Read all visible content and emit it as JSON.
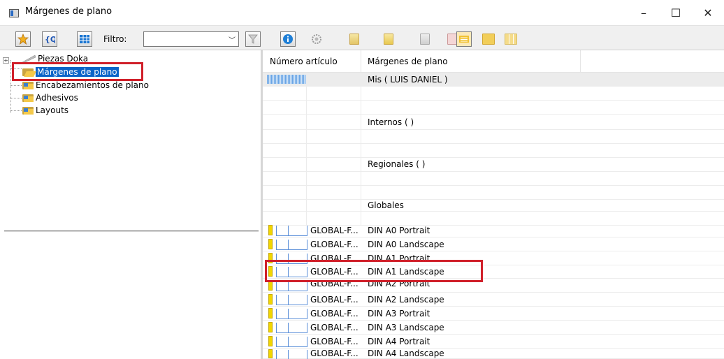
{
  "window": {
    "title": "Márgenes de plano",
    "min_glyph": "–",
    "max_glyph": "☐",
    "close_glyph": "✕"
  },
  "toolbar": {
    "filter_label": "Filtro:",
    "filter_value": "",
    "buttons": [
      "favorites-star-icon",
      "search-reload-icon",
      "grid-view-icon",
      "filter-funnel-icon",
      "info-icon",
      "settings-gear-icon",
      "document-1-icon",
      "document-2-icon",
      "document-3-icon",
      "list-view-icon",
      "details-view-icon",
      "columns-view-icon"
    ]
  },
  "tree": {
    "items": [
      {
        "label": "Piezas Doka"
      },
      {
        "label": "Márgenes de plano"
      },
      {
        "label": "Encabezamientos de plano"
      },
      {
        "label": "Adhesivos"
      },
      {
        "label": "Layouts"
      }
    ]
  },
  "grid": {
    "col_article": "Número artículo",
    "col_margins": "Márgenes de plano",
    "groups": {
      "mis": "Mis ( LUIS DANIEL )",
      "internos": "Internos ( )",
      "regionales": "Regionales ( )",
      "globales": "Globales"
    },
    "rows": [
      {
        "article": "GLOBAL-F...",
        "name": "DIN A0 Portrait"
      },
      {
        "article": "GLOBAL-F...",
        "name": "DIN A0 Landscape"
      },
      {
        "article": "GLOBAL-F...",
        "name": "DIN A1 Portrait"
      },
      {
        "article": "GLOBAL-F...",
        "name": "DIN A1 Landscape"
      },
      {
        "article": "GLOBAL-F...",
        "name": "DIN A2 Portrait"
      },
      {
        "article": "GLOBAL-F...",
        "name": "DIN A2 Landscape"
      },
      {
        "article": "GLOBAL-F...",
        "name": "DIN A3 Portrait"
      },
      {
        "article": "GLOBAL-F...",
        "name": "DIN A3 Landscape"
      },
      {
        "article": "GLOBAL-F...",
        "name": "DIN A4 Portrait"
      },
      {
        "article": "GLOBAL-F...",
        "name": "DIN A4 Landscape"
      }
    ]
  },
  "colors": {
    "selection": "#0a64c8",
    "highlight_box": "#d0202a",
    "folder": "#f4c94a"
  }
}
